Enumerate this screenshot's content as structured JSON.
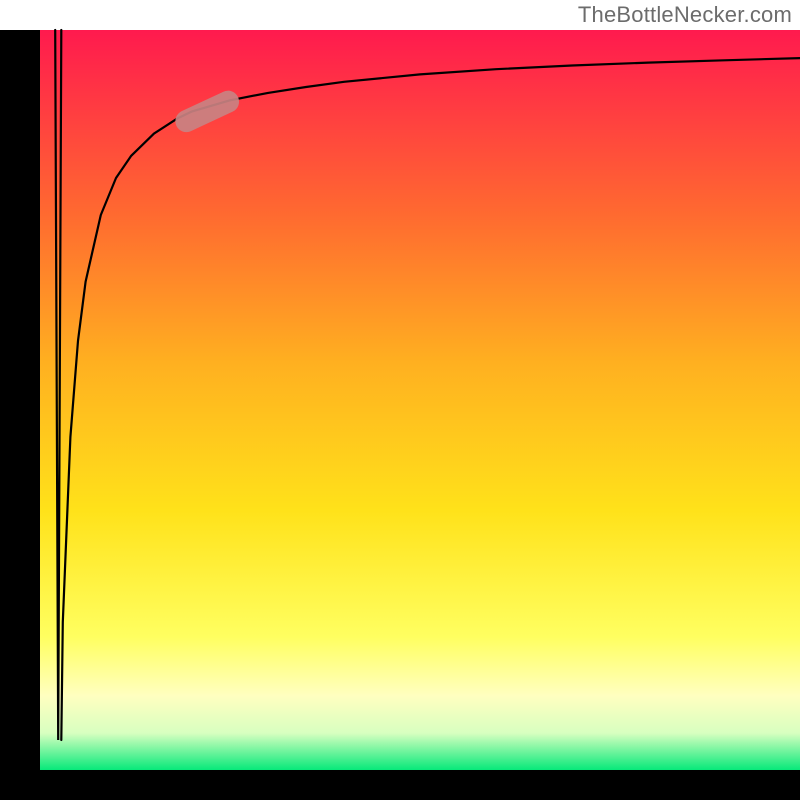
{
  "watermark": {
    "text": "TheBottleNecker.com"
  },
  "chart_data": {
    "type": "line",
    "title": "",
    "xlabel": "",
    "ylabel": "",
    "xlim": [
      0,
      100
    ],
    "ylim": [
      0,
      100
    ],
    "grid": false,
    "legend": false,
    "background_gradient": {
      "top": "#ff1a4e",
      "upper_mid": "#ff8b2a",
      "mid": "#ffe21a",
      "lower_mid": "#ffff70",
      "bottom_band": "#ffffd0",
      "bottom": "#07e97a"
    },
    "axes_color": "#000000",
    "series": [
      {
        "name": "spike-down",
        "color": "#000000",
        "x": [
          2.0,
          2.4,
          2.8
        ],
        "y": [
          100,
          4,
          100
        ]
      },
      {
        "name": "log-curve",
        "color": "#000000",
        "x": [
          2.8,
          3,
          4,
          5,
          6,
          8,
          10,
          12,
          15,
          18,
          20,
          25,
          30,
          35,
          40,
          50,
          60,
          70,
          80,
          90,
          100
        ],
        "y": [
          4,
          20,
          45,
          58,
          66,
          75,
          80,
          83,
          86,
          88,
          89,
          90.5,
          91.5,
          92.3,
          93,
          94,
          94.7,
          95.2,
          95.6,
          95.9,
          96.2
        ]
      }
    ],
    "marker": {
      "name": "highlight-pill",
      "color": "#c98282",
      "center_x": 22,
      "center_y": 89,
      "length": 9,
      "angle_deg": 25
    }
  }
}
